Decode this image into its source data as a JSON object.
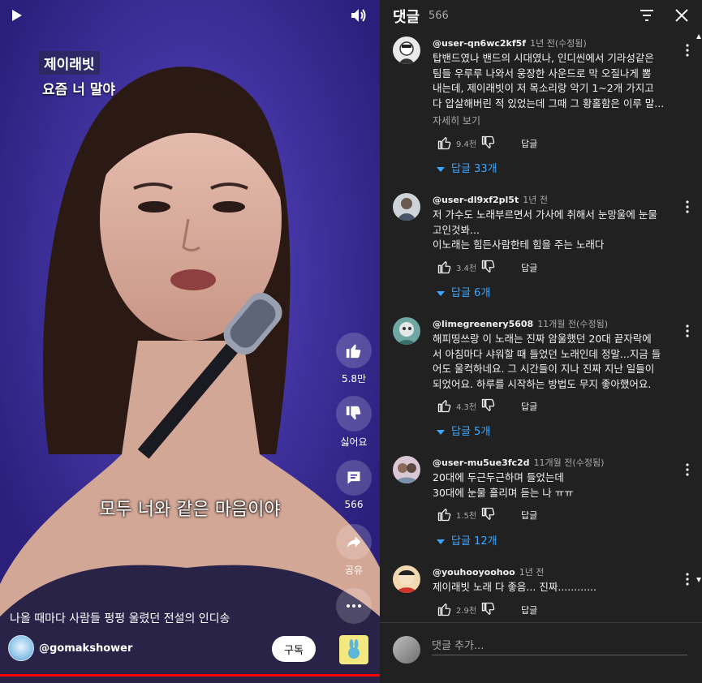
{
  "video": {
    "overlay_tag": "제이래빗",
    "overlay_sub": "요즘 너 말야",
    "subtitle": "모두 너와 같은 마음이야",
    "like_count": "5.8만",
    "dislike_label": "싫어요",
    "comment_count": "566",
    "share_label": "공유",
    "title": "나올 때마다 사람들 펑펑 울렸던 전설의 인디송",
    "channel": "@gomakshower",
    "subscribe_label": "구독",
    "progress": 1.0,
    "progress_color": "#ff0000"
  },
  "comments_panel": {
    "title": "댓글",
    "count": "566",
    "comments": [
      {
        "user": "@user-qn6wc2kf5f",
        "time": "1년 전(수정됨)",
        "lines": [
          "탑밴드였나 밴드의 시대였나, 인디씬에서 기라성같은",
          "팀들 우루루 나와서 웅장한 사운드로 막 오질나게 뽐",
          "내는데, 제이래빗이 저 목소리랑 악기 1~2개 가지고",
          "다 압살해버린 적 있었는데 그때 그 황홀함은 이루 말..."
        ],
        "detail": "자세히 보기",
        "likes": "9.4천",
        "reply_label": "답글",
        "replies": "답글 33개"
      },
      {
        "user": "@user-dl9xf2pl5t",
        "time": "1년 전",
        "lines": [
          "저 가수도 노래부르면서 가사에 취해서 눈망울에 눈물",
          "고인것봐...",
          "이노래는 힘든사람한테 힘을 주는 노래다"
        ],
        "likes": "3.4천",
        "reply_label": "답글",
        "replies": "답글 6개"
      },
      {
        "user": "@limegreenery5608",
        "time": "11개월 전(수정됨)",
        "lines": [
          "해피띵쓰랑 이 노래는 진짜 암울했던 20대 끝자락에",
          "서 아침마다 샤워할 때 들었던 노래인데 정말...지금 들",
          "어도 울컥하네요. 그 시간들이 지나 진짜 지난 일들이",
          "되었어요. 하루를 시작하는 방법도 무지 좋아했어요."
        ],
        "likes": "4.3천",
        "reply_label": "답글",
        "replies": "답글 5개"
      },
      {
        "user": "@user-mu5ue3fc2d",
        "time": "11개월 전(수정됨)",
        "lines": [
          "20대에 두근두근하며 들었는데",
          "30대에 눈물 흘리며 듣는 나 ㅠㅠ"
        ],
        "likes": "1.5천",
        "reply_label": "답글",
        "replies": "답글 12개"
      },
      {
        "user": "@youhooyoohoo",
        "time": "1년 전",
        "lines": [
          "제이래빗 노래 다 좋음... 진짜............"
        ],
        "likes": "2.9천",
        "reply_label": "답글"
      }
    ],
    "add_comment_placeholder": "댓글 추가...",
    "accent_color": "#3ea6ff"
  }
}
